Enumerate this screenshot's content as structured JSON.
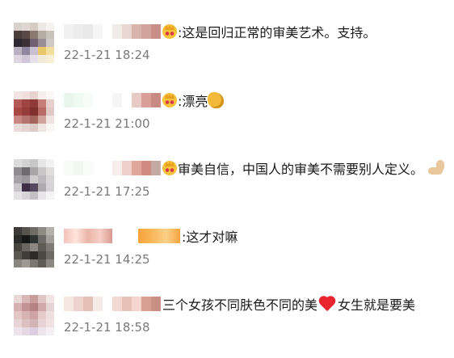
{
  "comments": [
    {
      "text": ":这是回归正常的审美艺术。支持。",
      "time": "22-1-21 18:24",
      "emoji": "crown-face-emoji",
      "trailing_emoji": null,
      "avatar_colors": [
        "#d9d2cc",
        "#e0d8d0",
        "#d6ccc4",
        "#ede8e4",
        "#f5f2ef",
        "#4a3e3a",
        "#5a4a45",
        "#8b7a70",
        "#b6ada5",
        "#c9c2ba",
        "#2e2830",
        "#3a3035",
        "#6e6070",
        "#9a8e96",
        "#d0c8c6",
        "#b9b0c0",
        "#8f86a0",
        "#c8c0d0",
        "#e8c86a",
        "#f2df9c",
        "#ddd6e0",
        "#cfc6d6",
        "#e6e0ea",
        "#f0ead8",
        "#f7f0d6"
      ],
      "name_colors": [
        "#f1f1f1",
        "#ededed",
        "#e9e9e9",
        "#f6f6f6",
        "#ffffff",
        "#f0ebe9",
        "#e8d6d2",
        "#d8b4ad",
        "#d2a39c",
        "#c98e88"
      ]
    },
    {
      "text": ":漂亮",
      "time": "22-1-21 21:00",
      "emoji": "crown-face-emoji",
      "trailing_emoji": "clap-emoji",
      "avatar_colors": [
        "#f2e6e4",
        "#f0dfdc",
        "#e7d3d0",
        "#f6eeec",
        "#faf7f6",
        "#b35a57",
        "#9e4441",
        "#8f3a38",
        "#c77e79",
        "#e6cfcc",
        "#a84845",
        "#953c3a",
        "#7e2f2e",
        "#b86a66",
        "#e1c8c4",
        "#c98781",
        "#b47570",
        "#a6645f",
        "#d1a29c",
        "#efe3e1",
        "#e9dcda",
        "#e3d3d1",
        "#dccac7",
        "#efe5e3",
        "#faf6f5"
      ],
      "name_colors": [
        "#e8f6ee",
        "#f0faf4",
        "#f7fcf9",
        "#ffffff",
        "#ffffff",
        "#f5f5f5",
        "#ffffff",
        "#e9c9c4",
        "#d99e97",
        "#c98a84"
      ]
    },
    {
      "text": "审美自信，中国人的审美不需要别人定义。",
      "time": "22-1-21 17:25",
      "emoji": "crown-face-emoji",
      "trailing_emoji": "flexed-biceps-emoji",
      "avatar_colors": [
        "#dcdcdc",
        "#d2d2d2",
        "#c8c8c8",
        "#e6e6e6",
        "#f2f2f2",
        "#8e8c8e",
        "#6e6b6f",
        "#a9a5a6",
        "#c9c5c6",
        "#e0dddd",
        "#a6a3a6",
        "#9b979a",
        "#d0cccd",
        "#bcb9bc",
        "#d8d5d6",
        "#c9c6c9",
        "#3e2f46",
        "#56485e",
        "#aeaaae",
        "#d6d3d6",
        "#e3e2e3",
        "#d7d4d8",
        "#c2bfc3",
        "#e7e5e7",
        "#f4f3f4"
      ],
      "name_colors": [
        "#f6fbf5",
        "#eff7ee",
        "#f9fcf8",
        "#ffffff",
        "#ffffff",
        "#f7eeec",
        "#efcfc9",
        "#e2a79c",
        "#d08b80",
        "#c4a9a5"
      ]
    },
    {
      "text": ":这才对嘛",
      "time": "22-1-21 14:25",
      "emoji": null,
      "trailing_emoji": null,
      "avatar_colors": [
        "#3b3a38",
        "#57534f",
        "#6f6b66",
        "#8e8a84",
        "#b4b0aa",
        "#2a2c2a",
        "#151816",
        "#2e3431",
        "#6d6c68",
        "#a29f99",
        "#47433f",
        "#6b655f",
        "#8d877f",
        "#5e5a54",
        "#7f7a73",
        "#5b5853",
        "#3f3d39",
        "#2d2b28",
        "#4b4844",
        "#6e6a64",
        "#8a857e",
        "#9e9891",
        "#7b766f",
        "#5f5b55",
        "#8d8881"
      ],
      "name_colors": [
        "#f9e2dd",
        "#f6c7bc",
        "#f4b5a8",
        "#fbe8e3",
        "#f0b3a8",
        "#e6a39a",
        "#fbebe8",
        "#f8dcd5",
        "#e8a296",
        "#f4f4f4"
      ]
    },
    {
      "text": "三个女孩不同肤色不同的美",
      "text2": "女生就是要美",
      "time": "22-1-21 18:58",
      "emoji": null,
      "trailing_emoji": "red-heart-emoji",
      "avatar_colors": [
        "#e9d8d8",
        "#d9b7b7",
        "#c99c9c",
        "#e1c6c6",
        "#f1e4e4",
        "#d6b0b0",
        "#c39393",
        "#b58383",
        "#cfa9a9",
        "#e6d3d3",
        "#e4c5c5",
        "#d7b2b2",
        "#cfa3a3",
        "#e6cbcb",
        "#efe0e0",
        "#e8d4d4",
        "#dcc0c0",
        "#d3b4b4",
        "#e7d3d3",
        "#f0e2e2",
        "#ece4ea",
        "#e4d9e3",
        "#dccde0",
        "#ede4ec",
        "#f6f0f4"
      ],
      "name_colors": [
        "#f6e7e3",
        "#eed3cc",
        "#e5c0b6",
        "#f7ebe7",
        "#ffffff",
        "#f3d9d3",
        "#e7c0b6",
        "#f5d7cf",
        "#d89e92",
        "#c98f84"
      ]
    }
  ]
}
